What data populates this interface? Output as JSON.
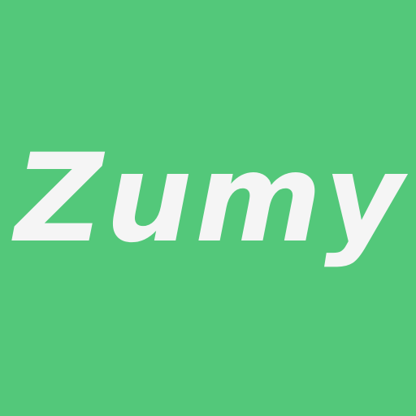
{
  "logo": {
    "text": "Zumy",
    "text_color": "#f5f5f5"
  },
  "background_color": "#53c87a"
}
